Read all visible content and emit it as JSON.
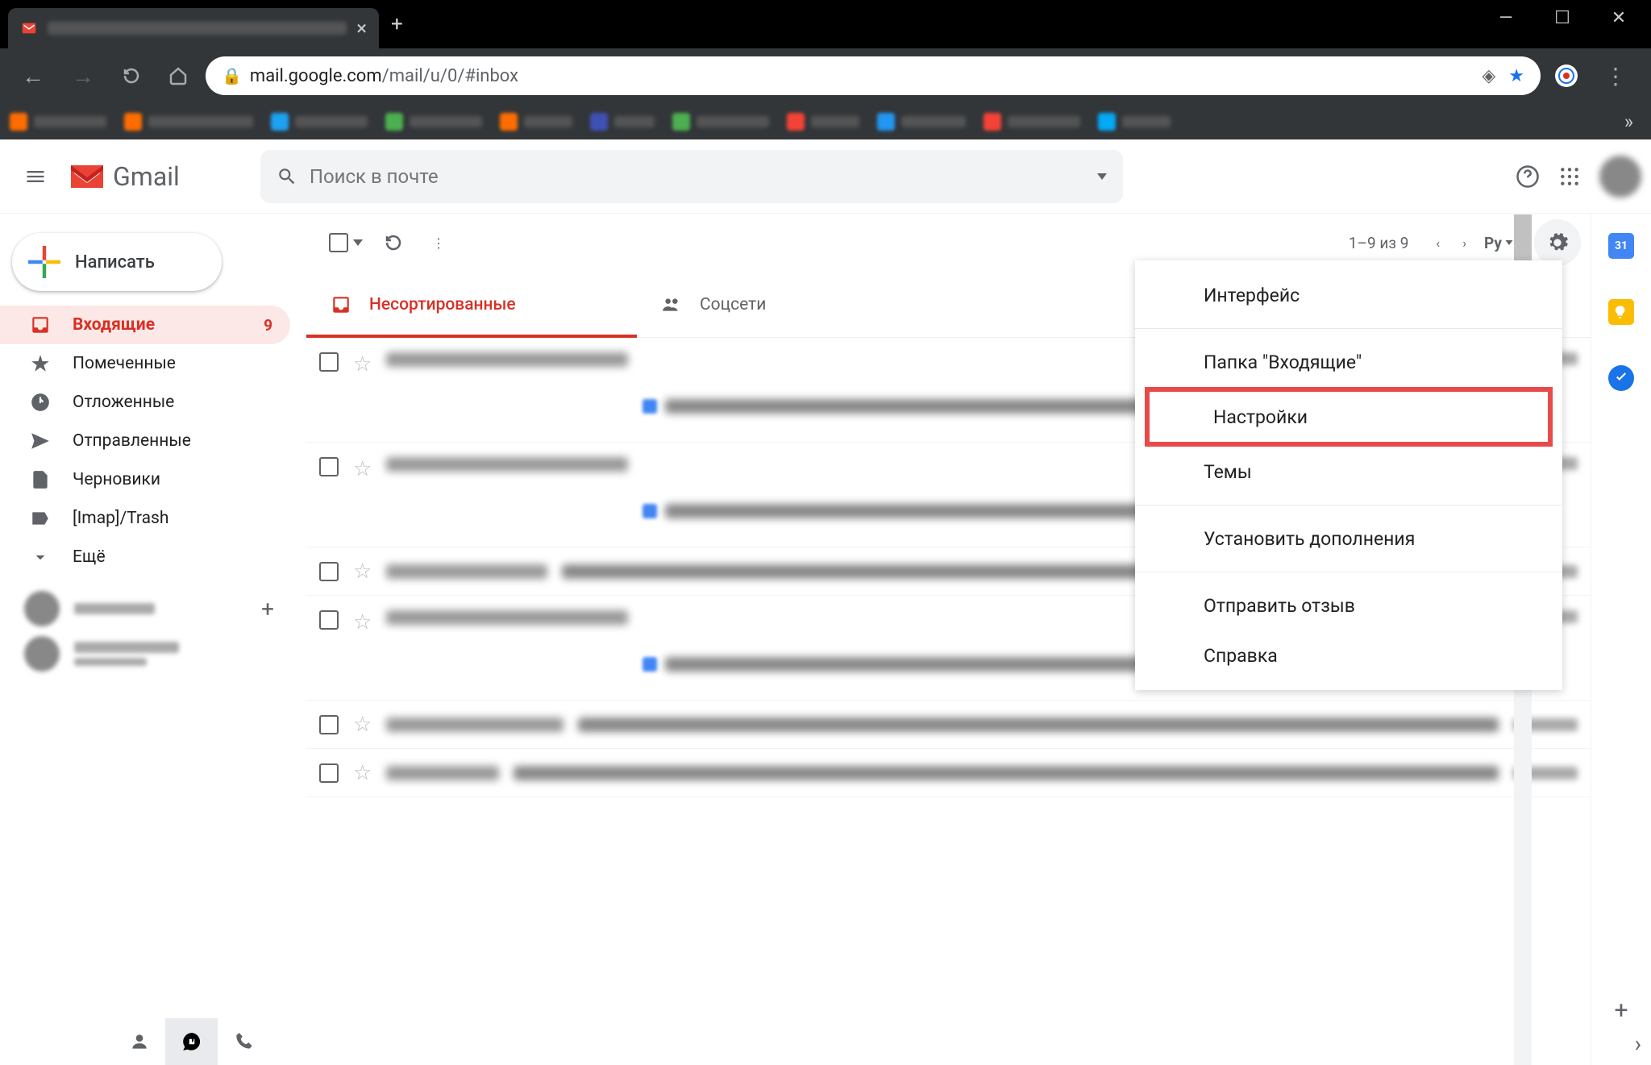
{
  "browser": {
    "url_domain": "mail.google.com",
    "url_path": "/mail/u/0/#inbox"
  },
  "gmail": {
    "brand": "Gmail",
    "search_placeholder": "Поиск в почте",
    "compose": "Написать",
    "sidebar": {
      "items": [
        {
          "label": "Входящие",
          "count": "9"
        },
        {
          "label": "Помеченные"
        },
        {
          "label": "Отложенные"
        },
        {
          "label": "Отправленные"
        },
        {
          "label": "Черновики"
        },
        {
          "label": "[Imap]/Trash"
        },
        {
          "label": "Ещё"
        }
      ]
    },
    "toolbar": {
      "page_info": "1–9 из 9",
      "input_tool": "Ру"
    },
    "tabs": {
      "primary": "Несортированные",
      "social": "Соцсети"
    },
    "settings_menu": {
      "display_density": "Интерфейс",
      "inbox_folder": "Папка \"Входящие\"",
      "settings": "Настройки",
      "themes": "Темы",
      "addons": "Установить дополнения",
      "feedback": "Отправить отзыв",
      "help": "Справка"
    },
    "calendar_day": "31"
  }
}
